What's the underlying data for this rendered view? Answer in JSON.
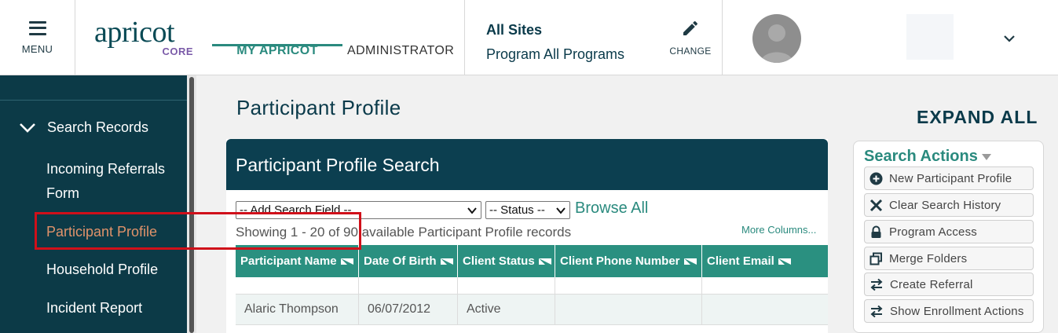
{
  "header": {
    "menu_label": "MENU",
    "logo_word": "apricot",
    "logo_sub": "CORE",
    "tabs": [
      {
        "label": "MY APRICOT"
      },
      {
        "label": "ADMINISTRATOR"
      }
    ],
    "sites_title": "All Sites",
    "program_label": "Program All Programs",
    "change_label": "CHANGE"
  },
  "sidebar": {
    "section": "Search Records",
    "items": [
      {
        "label": "Incoming Referrals Form"
      },
      {
        "label": "Participant Profile"
      },
      {
        "label": "Household Profile"
      },
      {
        "label": "Incident Report"
      }
    ]
  },
  "main": {
    "page_title": "Participant Profile",
    "expand_all": "EXPAND ALL",
    "panel_title": "Participant Profile Search",
    "add_field_select": "-- Add Search Field --",
    "status_select": "-- Status --",
    "browse_all": "Browse All",
    "showing_text": "Showing 1 - 20 of 90 available Participant Profile records",
    "more_columns": "More Columns...",
    "columns": [
      "Participant Name",
      "Date Of Birth",
      "Client Status",
      "Client Phone Number",
      "Client Email"
    ],
    "rows": [
      {
        "name": "Alaric Thompson",
        "dob": "06/07/2012",
        "status": "Active",
        "phone": "",
        "email": ""
      }
    ]
  },
  "actions": {
    "title": "Search Actions",
    "buttons": [
      {
        "label": "New Participant Profile",
        "icon": "plus-circle-icon"
      },
      {
        "label": "Clear Search History",
        "icon": "x-icon"
      },
      {
        "label": "Program Access",
        "icon": "lock-icon"
      },
      {
        "label": "Merge Folders",
        "icon": "merge-icon"
      },
      {
        "label": "Create Referral",
        "icon": "swap-arrows-icon"
      },
      {
        "label": "Show Enrollment Actions",
        "icon": "swap-arrows-icon"
      }
    ]
  },
  "colors": {
    "navy": "#0c3a47",
    "teal": "#2a9080",
    "accent_orange": "#e0926a",
    "highlight_red": "#d0101a"
  }
}
